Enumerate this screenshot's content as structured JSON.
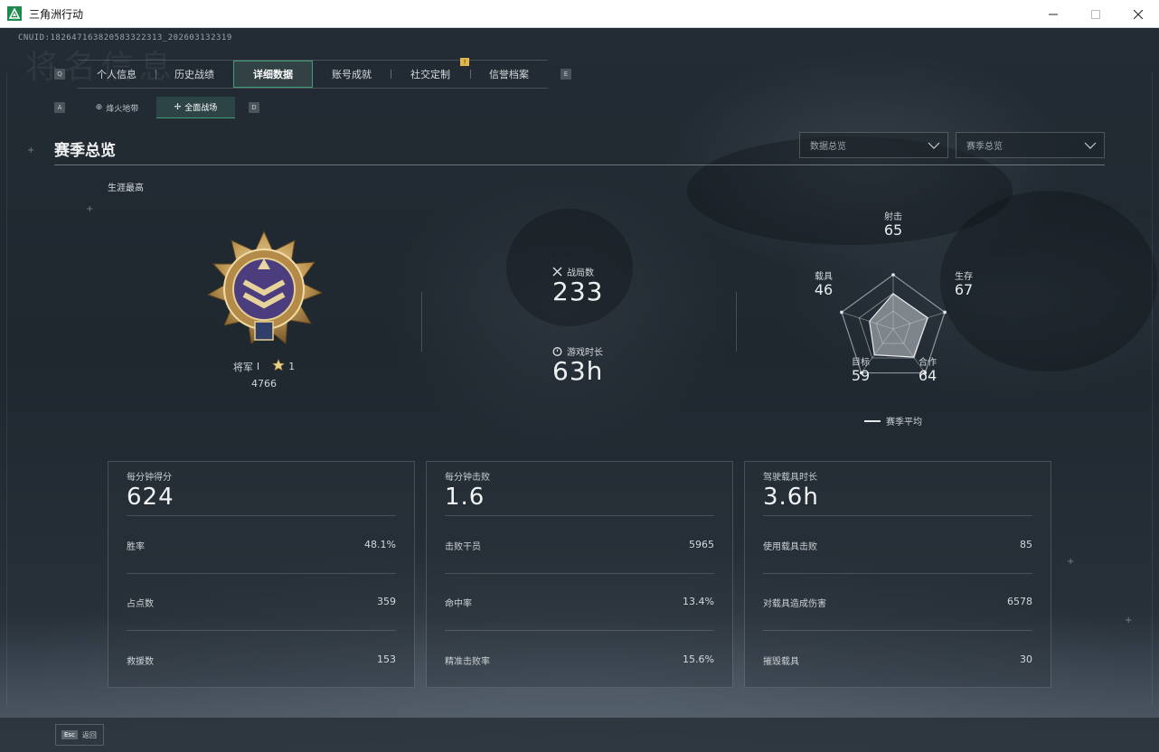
{
  "window": {
    "title": "三角洲行动"
  },
  "cnuid": "CNUID:1826471638205833223​13_202603132319",
  "watermark": "将名信息",
  "key_hints": {
    "tab_left": "Q",
    "tab_right": "E",
    "sub_left": "A",
    "sub_right": "D"
  },
  "main_tabs": [
    {
      "label": "个人信息",
      "active": false
    },
    {
      "label": "历史战绩",
      "active": false
    },
    {
      "label": "详细数据",
      "active": true
    },
    {
      "label": "账号成就",
      "active": false
    },
    {
      "label": "社交定制",
      "active": false
    },
    {
      "label": "信誉档案",
      "active": false
    }
  ],
  "notification_badge": "!",
  "sub_tabs": [
    {
      "label": "烽火地带",
      "icon": "crosshair-icon",
      "active": false
    },
    {
      "label": "全面战场",
      "icon": "wings-icon",
      "active": true
    }
  ],
  "section": {
    "title": "赛季总览"
  },
  "dropdowns": {
    "data": "数据总览",
    "season": "赛季总览"
  },
  "career": {
    "label": "生涯最高",
    "rank_name": "将军",
    "rank_tier": "I",
    "stars": "1",
    "score": "4766"
  },
  "summary": {
    "matches_label": "战局数",
    "matches_value": "233",
    "playtime_label": "游戏时长",
    "playtime_value": "63h"
  },
  "radar": {
    "axes": [
      {
        "label": "射击",
        "value": "65"
      },
      {
        "label": "生存",
        "value": "67"
      },
      {
        "label": "合作",
        "value": "64"
      },
      {
        "label": "目标",
        "value": "59"
      },
      {
        "label": "载具",
        "value": "46"
      }
    ],
    "legend": "赛季平均"
  },
  "cards": [
    {
      "title": "每分钟得分",
      "value": "624",
      "rows": [
        {
          "label": "胜率",
          "value": "48.1%"
        },
        {
          "label": "占点数",
          "value": "359"
        },
        {
          "label": "救援数",
          "value": "153"
        }
      ]
    },
    {
      "title": "每分钟击败",
      "value": "1.6",
      "rows": [
        {
          "label": "击败干员",
          "value": "5965"
        },
        {
          "label": "命中率",
          "value": "13.4%"
        },
        {
          "label": "精准击败率",
          "value": "15.6%"
        }
      ]
    },
    {
      "title": "驾驶载具时长",
      "value": "3.6h",
      "rows": [
        {
          "label": "使用载具击败",
          "value": "85"
        },
        {
          "label": "对载具造成伤害",
          "value": "6578"
        },
        {
          "label": "摧毁载具",
          "value": "30"
        }
      ]
    }
  ],
  "bottom": {
    "esc_key": "Esc",
    "esc_label": "返回"
  },
  "colors": {
    "accent": "#3f9d7a",
    "badge": "#e2b64a",
    "gold": "#c9a45a",
    "purple": "#5a4a8a"
  }
}
